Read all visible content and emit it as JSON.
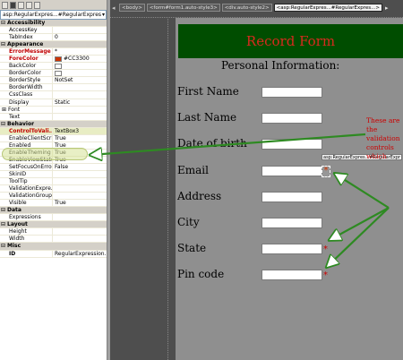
{
  "properties": {
    "object_selector": "asp:RegularExpres...#RegularExpres",
    "toolbar_icons": [
      "categorized-icon",
      "alphabetical-icon",
      "properties-icon",
      "events-icon",
      "property-pages-icon"
    ],
    "rows": [
      {
        "type": "cat",
        "name": "Accessibility"
      },
      {
        "type": "prop",
        "name": "AccessKey",
        "value": ""
      },
      {
        "type": "prop",
        "name": "TabIndex",
        "value": "0"
      },
      {
        "type": "cat",
        "name": "Appearance"
      },
      {
        "type": "prop",
        "name": "ErrorMessage",
        "value": "*",
        "style": "red"
      },
      {
        "type": "prop",
        "name": "ForeColor",
        "value": "#CC3300",
        "style": "red",
        "swatch": "#cc3300"
      },
      {
        "type": "prop",
        "name": "BackColor",
        "value": "",
        "swatch": "#ffffff"
      },
      {
        "type": "prop",
        "name": "BorderColor",
        "value": "",
        "swatch": "#ffffff"
      },
      {
        "type": "prop",
        "name": "BorderStyle",
        "value": "NotSet"
      },
      {
        "type": "prop",
        "name": "BorderWidth",
        "value": ""
      },
      {
        "type": "prop",
        "name": "CssClass",
        "value": ""
      },
      {
        "type": "prop",
        "name": "Display",
        "value": "Static"
      },
      {
        "type": "prop",
        "name": "Font",
        "value": "",
        "style": "exp"
      },
      {
        "type": "prop",
        "name": "Text",
        "value": ""
      },
      {
        "type": "cat",
        "name": "Behavior"
      },
      {
        "type": "prop",
        "name": "ControlToVali...",
        "value": "TextBox3",
        "style": "red sel"
      },
      {
        "type": "prop",
        "name": "EnableClientScript",
        "value": "True"
      },
      {
        "type": "prop",
        "name": "Enabled",
        "value": "True"
      },
      {
        "type": "prop",
        "name": "EnableTheming",
        "value": "True"
      },
      {
        "type": "prop",
        "name": "EnableViewState",
        "value": "True"
      },
      {
        "type": "prop",
        "name": "SetFocusOnError",
        "value": "False"
      },
      {
        "type": "prop",
        "name": "SkinID",
        "value": ""
      },
      {
        "type": "prop",
        "name": "ToolTip",
        "value": ""
      },
      {
        "type": "prop",
        "name": "ValidationExpre...",
        "value": ""
      },
      {
        "type": "prop",
        "name": "ValidationGroup",
        "value": ""
      },
      {
        "type": "prop",
        "name": "Visible",
        "value": "True"
      },
      {
        "type": "cat",
        "name": "Data"
      },
      {
        "type": "prop",
        "name": "Expressions",
        "value": ""
      },
      {
        "type": "cat",
        "name": "Layout"
      },
      {
        "type": "prop",
        "name": "Height",
        "value": ""
      },
      {
        "type": "prop",
        "name": "Width",
        "value": ""
      },
      {
        "type": "cat",
        "name": "Misc"
      },
      {
        "type": "prop",
        "name": "ID",
        "value": "RegularExpression...",
        "style": "bold"
      }
    ]
  },
  "designer": {
    "breadcrumb": [
      "<body>",
      "<form#form1.auto-style3>",
      "<div.auto-style2>",
      "<asp:RegularExpres...#RegularExpres...>"
    ],
    "breadcrumb_active_index": 3
  },
  "form": {
    "title": "Record Form",
    "title_bg": "#004d00",
    "title_color": "#d82a1e",
    "subtitle": "Personal Information:",
    "fields": [
      {
        "label": "First Name",
        "star": false
      },
      {
        "label": "Last Name",
        "star": false
      },
      {
        "label": "Date of birth",
        "star": false
      },
      {
        "label": "Email",
        "star": true,
        "selected": true
      },
      {
        "label": "Address",
        "star": false
      },
      {
        "label": "City",
        "star": false
      },
      {
        "label": "State",
        "star": true
      },
      {
        "label": "Pin code",
        "star": true
      }
    ],
    "star_text": "*",
    "validator_tag": "asp:RegularExpres...#RegularExpr"
  },
  "annotation": {
    "callout": "These are the validation controls which",
    "color": "#cc0000",
    "arrow_color": "#3a9a2a"
  }
}
